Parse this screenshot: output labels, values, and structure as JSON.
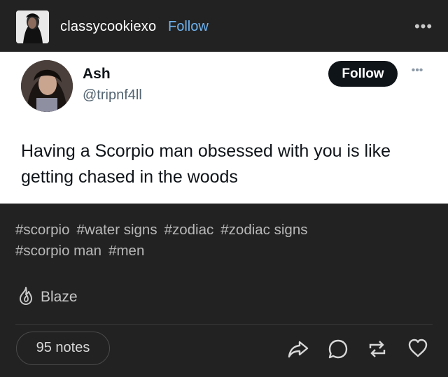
{
  "header": {
    "username": "classycookiexo",
    "follow_label": "Follow",
    "more_label": "•••"
  },
  "tweet": {
    "name": "Ash",
    "handle": "@tripnf4ll",
    "follow_label": "Follow",
    "more_label": "•••",
    "text": "Having a Scorpio man obsessed with you is like getting chased in the woods"
  },
  "tags": [
    "#scorpio",
    "#water signs",
    "#zodiac",
    "#zodiac signs",
    "#scorpio man",
    "#men"
  ],
  "blaze_label": "Blaze",
  "notes_label": "95 notes",
  "icons": {
    "blaze": "flame-icon",
    "share": "share-icon",
    "reply": "reply-icon",
    "reblog": "reblog-icon",
    "like": "heart-icon"
  },
  "colors": {
    "background": "#222222",
    "follow_link": "#6fb3ef",
    "tweet_background": "#ffffff"
  }
}
